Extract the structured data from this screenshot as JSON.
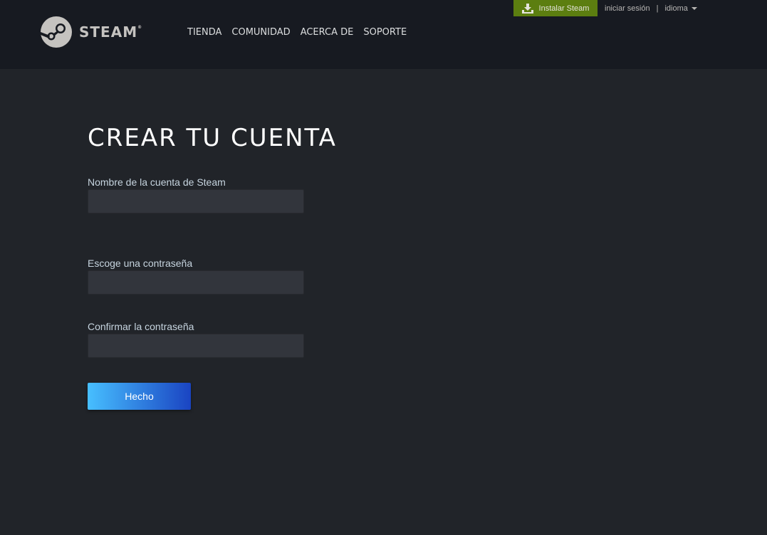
{
  "header": {
    "logo_text": "STEAM",
    "logo_reg": "®",
    "nav": [
      "TIENDA",
      "COMUNIDAD",
      "ACERCA DE",
      "SOPORTE"
    ],
    "install_label": "Instalar Steam",
    "login_label": "iniciar sesión",
    "separator": "|",
    "language_label": "idioma"
  },
  "main": {
    "title": "CREAR TU CUENTA",
    "fields": [
      {
        "label": "Nombre de la cuenta de Steam",
        "value": ""
      },
      {
        "label": "Escoge una contraseña",
        "value": ""
      },
      {
        "label": "Confirmar la contraseña",
        "value": ""
      }
    ],
    "submit_label": "Hecho"
  },
  "colors": {
    "background": "#212429",
    "header_bg": "#171a21",
    "install_green": "#5c7e10",
    "input_bg": "#32353c",
    "button_gradient_start": "#47bfff",
    "button_gradient_end": "#1a44c2"
  },
  "icons": {
    "logo": "steam-logo-icon",
    "install": "download-icon",
    "language_caret": "caret-down-icon"
  }
}
